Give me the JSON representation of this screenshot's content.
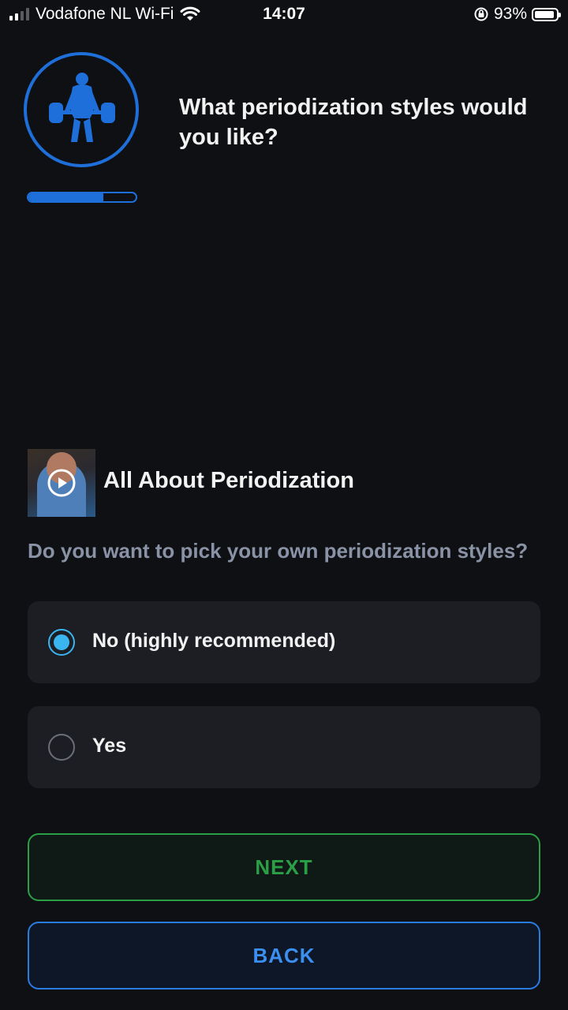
{
  "status_bar": {
    "carrier": "Vodafone NL Wi-Fi",
    "time": "14:07",
    "battery_percent": "93%",
    "signal_bars": 2,
    "icons": [
      "signal-icon",
      "wifi-icon",
      "orientation-lock-icon",
      "battery-icon"
    ]
  },
  "header": {
    "logo_icon": "weightlifter-icon",
    "title": "What periodization styles would you like?",
    "progress": 0.7,
    "accent_color": "#1e6fd9"
  },
  "video": {
    "title": "All About Periodization",
    "play_icon": "play-icon"
  },
  "question": {
    "text": "Do you want to pick your own periodization styles?",
    "options": [
      {
        "label": "No (highly recommended)",
        "selected": true
      },
      {
        "label": "Yes",
        "selected": false
      }
    ]
  },
  "buttons": {
    "next_label": "NEXT",
    "back_label": "BACK",
    "next_color": "#2a9f46",
    "back_color": "#2a7be0"
  }
}
